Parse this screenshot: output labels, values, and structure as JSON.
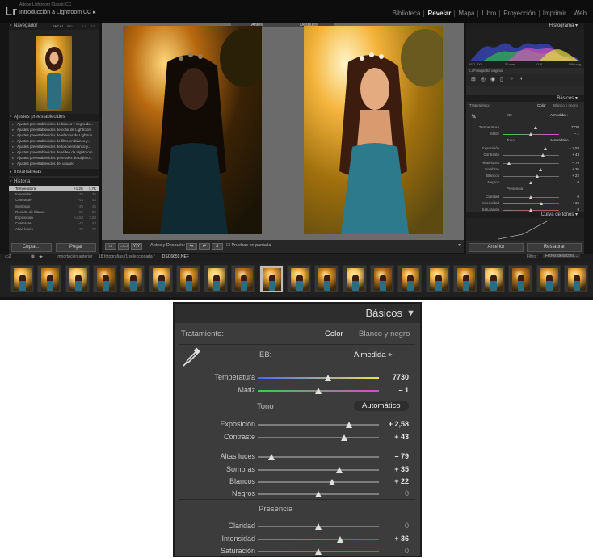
{
  "app": {
    "product": "Adobe Lightroom Classic CC",
    "catalog": "Introducción a Lightroom CC",
    "logo": "Lr",
    "modules": [
      "Biblioteca",
      "Revelar",
      "Mapa",
      "Libro",
      "Proyección",
      "Imprimir",
      "Web"
    ],
    "active_module": "Revelar"
  },
  "left_panel": {
    "navigator": {
      "title": "Navegador",
      "zoom_options": [
        "ENCAJ.",
        "RELL.",
        "1:1",
        "1:3"
      ]
    },
    "presets": {
      "title": "Ajustes preestablecidos",
      "items": [
        "Ajustes preestablecidos de blanco y negro de...",
        "Ajustes preestablecidos de color de Lightroom",
        "Ajustes preestablecidos de efectos de Lightroo...",
        "Ajustes preestablecidos de filtro en blanco y...",
        "Ajustes preestablecidos de tono en blanco y...",
        "Ajustes preestablecidos de vídeo de Lightroom",
        "Ajustes preestablecidos generales de Lightro...",
        "Ajustes preestablecidos del usuario"
      ]
    },
    "snapshots": {
      "title": "Instantáneas"
    },
    "history": {
      "title": "Historia",
      "items": [
        {
          "label": "Temperatura",
          "v1": "+1,2K",
          "v2": "7,7K"
        },
        {
          "label": "Intensidad",
          "v1": "+36",
          "v2": "36"
        },
        {
          "label": "Contraste",
          "v1": "+43",
          "v2": "43"
        },
        {
          "label": "Sombras",
          "v1": "+35",
          "v2": "35"
        },
        {
          "label": "Recorte de blanco",
          "v1": "+22",
          "v2": "22"
        },
        {
          "label": "Exposición",
          "v1": "+2,58",
          "v2": "2,58"
        },
        {
          "label": "Contraste",
          "v1": "+43",
          "v2": "43"
        },
        {
          "label": "Altas luces",
          "v1": "-79",
          "v2": "-79"
        }
      ]
    },
    "copy_button": "Copiar...",
    "paste_button": "Pegar"
  },
  "center": {
    "before_label": "Antes",
    "after_label": "Después",
    "toolbar": {
      "view_mode": "Y|Y",
      "before_after_label": "Antes y Después:",
      "soft_proof_label": "Pruebas en pantalla"
    }
  },
  "right_panel": {
    "histogram": {
      "title": "Histograma",
      "iso": "ISO 100",
      "focal": "50 mm",
      "aperture": "f/1,8",
      "shutter": "1/80 seg",
      "original_photo_label": "Fotografía original"
    },
    "basic": {
      "title": "Básicos",
      "treatment_label": "Tratamiento:",
      "treatment_color": "Color",
      "treatment_bw": "Blanco y negro",
      "wb_label": "EB:",
      "wb_value": "A medida ÷",
      "tone_label": "Tono",
      "auto_label": "Automático",
      "presence_label": "Presencia",
      "sliders": [
        {
          "label": "Temperatura",
          "value": "7730",
          "pos": 0.58,
          "group": "wb"
        },
        {
          "label": "Matiz",
          "value": "– 1",
          "pos": 0.5,
          "group": "wb"
        },
        {
          "label": "Exposición",
          "value": "+ 2,58",
          "pos": 0.75,
          "group": "tone"
        },
        {
          "label": "Contraste",
          "value": "+ 43",
          "pos": 0.71,
          "group": "tone"
        },
        {
          "label": "Altas luces",
          "value": "– 79",
          "pos": 0.11,
          "group": "tone2"
        },
        {
          "label": "Sombras",
          "value": "+ 35",
          "pos": 0.67,
          "group": "tone2"
        },
        {
          "label": "Blancos",
          "value": "+ 22",
          "pos": 0.61,
          "group": "tone2"
        },
        {
          "label": "Negros",
          "value": "0",
          "pos": 0.5,
          "group": "tone2"
        },
        {
          "label": "Claridad",
          "value": "0",
          "pos": 0.5,
          "group": "presence"
        },
        {
          "label": "Intensidad",
          "value": "+ 36",
          "pos": 0.68,
          "group": "presence"
        },
        {
          "label": "Saturación",
          "value": "0",
          "pos": 0.5,
          "group": "presence"
        }
      ]
    },
    "tone_curve": {
      "title": "Curva de tonos"
    },
    "previous_button": "Anterior",
    "reset_button": "Restaurar"
  },
  "filmstrip": {
    "source": "Importación anterior",
    "count": "18 fotografías /1 seleccionada /",
    "file": "_DSC6659.NEF",
    "filter_label": "Filtro :",
    "filter_value": "Filtros desactiva...",
    "thumb_count": 21,
    "selected_index": 9
  },
  "colors": {
    "panel_bg": "#2a2a2a",
    "accent_active": "#e6e6e6",
    "temp_track_start": "#3f6cff",
    "temp_track_end": "#f3e14a",
    "tint_track_start": "#37d046",
    "tint_track_end": "#d94ad0",
    "vibrance_track_end": "#e03040"
  }
}
